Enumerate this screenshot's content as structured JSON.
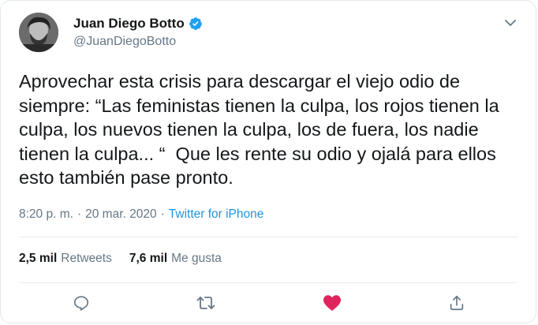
{
  "user": {
    "display_name": "Juan Diego Botto",
    "handle": "@JuanDiegoBotto",
    "verified": true
  },
  "tweet": {
    "text": "Aprovechar esta crisis para descargar el viejo odio de siempre: “Las feministas tienen la culpa, los rojos tienen la culpa, los nuevos tienen la culpa, los de fuera, los nadie tienen la culpa... “  Que les rente su odio y ojalá para ellos esto también pase pronto.",
    "time": "8:20 p. m.",
    "separator": "·",
    "date": "20 mar. 2020",
    "source": "Twitter for iPhone"
  },
  "stats": {
    "retweets_count": "2,5 mil",
    "retweets_label": "Retweets",
    "likes_count": "7,6 mil",
    "likes_label": "Me gusta"
  },
  "actions": [
    "reply-icon",
    "retweet-icon",
    "heart-icon",
    "share-icon"
  ],
  "colors": {
    "text": "#14171a",
    "secondary": "#657786",
    "link": "#1b95e0",
    "verified": "#1da1f2",
    "like": "#e0245e",
    "divider": "#e6ecf0"
  }
}
